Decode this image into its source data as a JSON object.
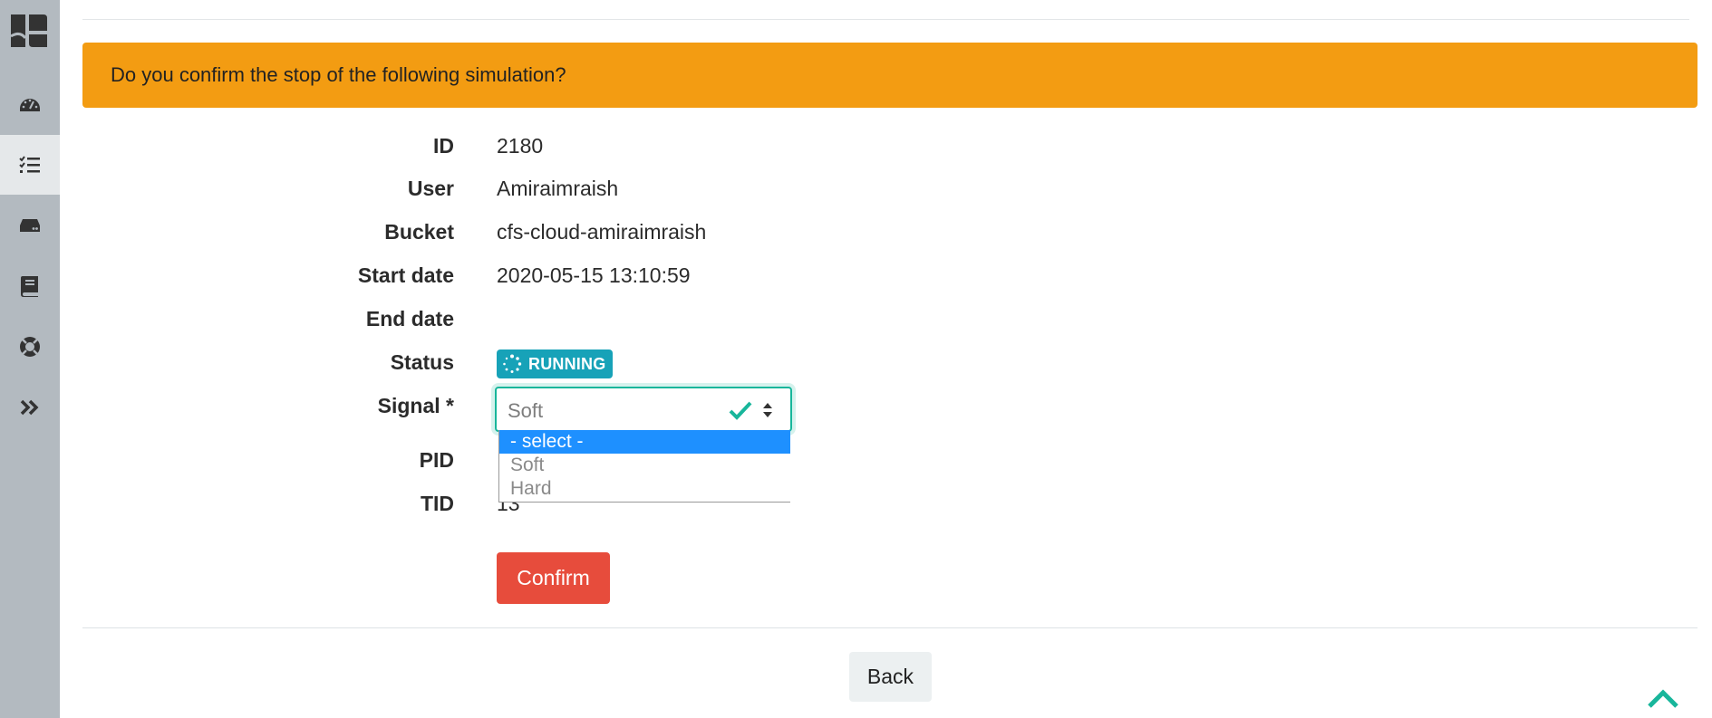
{
  "sidebar": {
    "logo_icon": "logo-icon",
    "items": [
      {
        "icon": "dashboard-gauge-icon",
        "active": false
      },
      {
        "icon": "task-list-icon",
        "active": true
      },
      {
        "icon": "storage-drive-icon",
        "active": false
      },
      {
        "icon": "book-icon",
        "active": false
      },
      {
        "icon": "lifebuoy-icon",
        "active": false
      },
      {
        "icon": "double-chevron-right-icon",
        "active": false
      }
    ]
  },
  "alert": {
    "message": "Do you confirm the stop of the following simulation?",
    "color": "#f39c12"
  },
  "details": {
    "id_label": "ID",
    "id_value": "2180",
    "user_label": "User",
    "user_value": "Amiraimraish",
    "bucket_label": "Bucket",
    "bucket_value": "cfs-cloud-amiraimraish",
    "start_label": "Start date",
    "start_value": "2020-05-15 13:10:59",
    "end_label": "End date",
    "end_value": "",
    "status_label": "Status",
    "status_value": "RUNNING",
    "signal_label": "Signal *",
    "pid_label": "PID",
    "tid_label": "TID",
    "tid_value": "13"
  },
  "signal_select": {
    "selected_value": "Soft",
    "options": [
      "- select -",
      "Soft",
      "Hard"
    ],
    "highlighted_index": 0,
    "valid_color": "#18b69b"
  },
  "actions": {
    "confirm_label": "Confirm",
    "confirm_color": "#e74c3c",
    "back_label": "Back"
  },
  "status_color": "#17a2b8",
  "scroll_top_icon": "chevron-up-icon"
}
